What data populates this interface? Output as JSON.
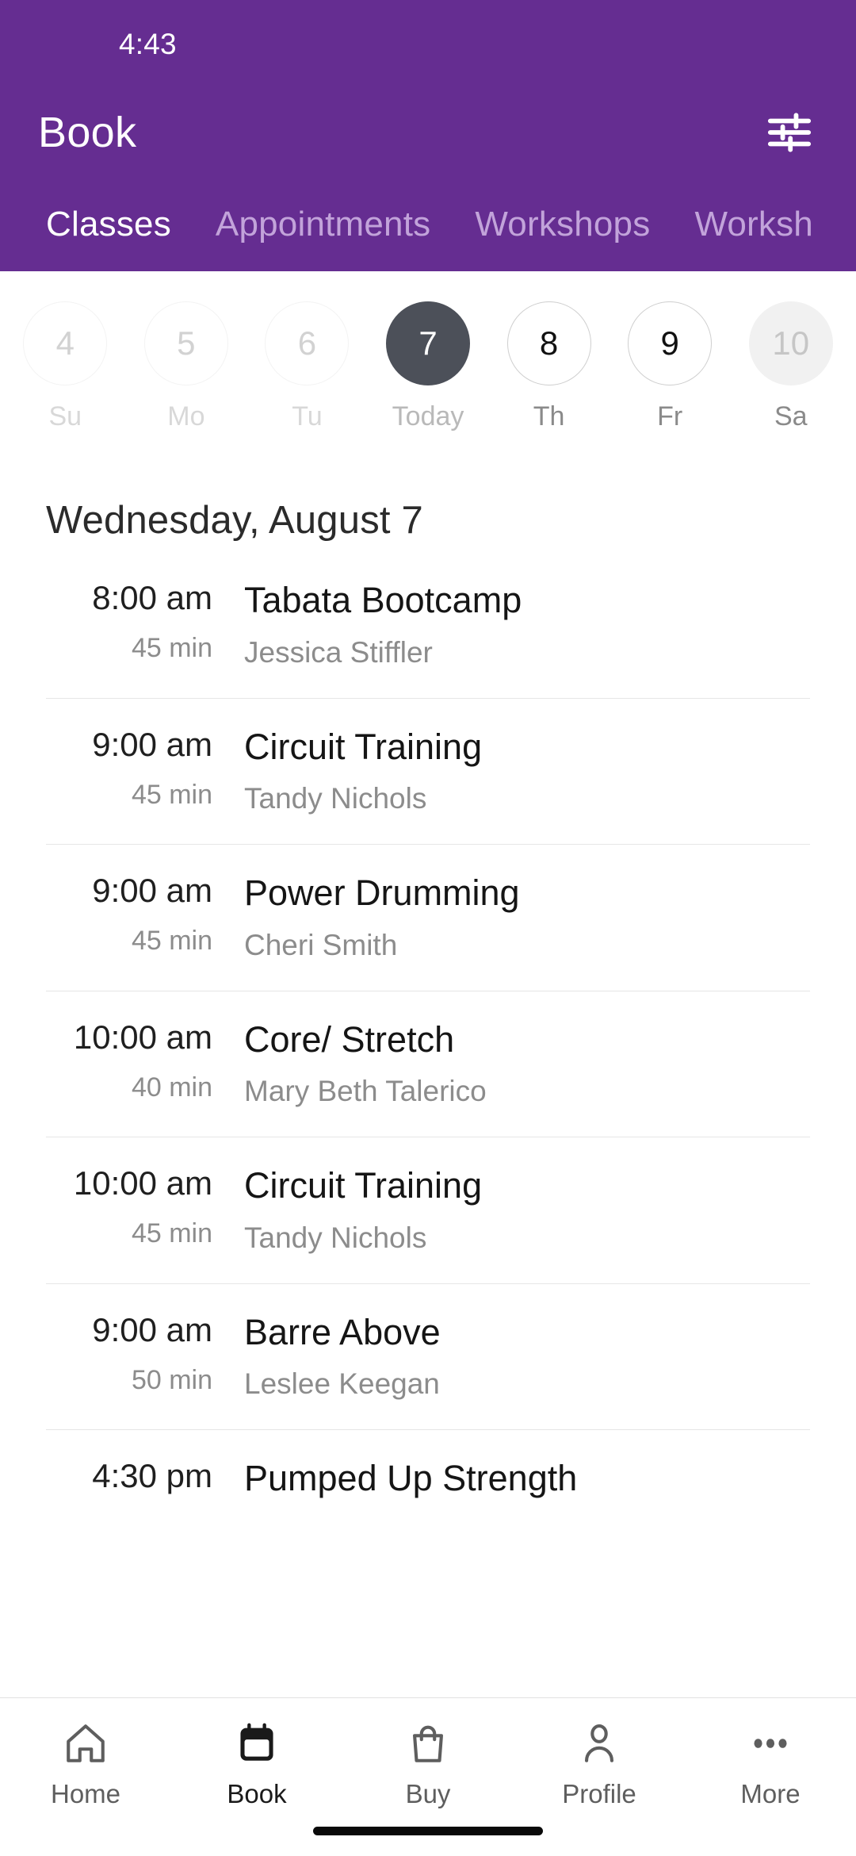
{
  "status_bar": {
    "time": "4:43"
  },
  "header": {
    "title": "Book",
    "filter_icon": "sliders-filter-icon",
    "background_color": "#652D91",
    "tabs": [
      {
        "label": "Classes",
        "active": true
      },
      {
        "label": "Appointments",
        "active": false
      },
      {
        "label": "Workshops",
        "active": false
      },
      {
        "label": "Worksh",
        "active": false
      }
    ]
  },
  "date_strip": {
    "days": [
      {
        "date": "4",
        "label": "Su",
        "state": "past"
      },
      {
        "date": "5",
        "label": "Mo",
        "state": "past"
      },
      {
        "date": "6",
        "label": "Tu",
        "state": "past"
      },
      {
        "date": "7",
        "label": "Today",
        "state": "today"
      },
      {
        "date": "8",
        "label": "Th",
        "state": "avail"
      },
      {
        "date": "9",
        "label": "Fr",
        "state": "avail"
      },
      {
        "date": "10",
        "label": "Sa",
        "state": "muted"
      }
    ],
    "selected_color": "#4C5059"
  },
  "day_heading": "Wednesday, August 7",
  "classes": [
    {
      "time": "8:00 am",
      "duration": "45 min",
      "name": "Tabata Bootcamp",
      "instructor": "Jessica Stiffler"
    },
    {
      "time": "9:00 am",
      "duration": "45 min",
      "name": "Circuit Training",
      "instructor": "Tandy Nichols"
    },
    {
      "time": "9:00 am",
      "duration": "45 min",
      "name": "Power Drumming",
      "instructor": "Cheri Smith"
    },
    {
      "time": "10:00 am",
      "duration": "40 min",
      "name": "Core/ Stretch",
      "instructor": "Mary Beth Talerico"
    },
    {
      "time": "10:00 am",
      "duration": "45 min",
      "name": "Circuit Training",
      "instructor": "Tandy Nichols"
    },
    {
      "time": "9:00 am",
      "duration": "50 min",
      "name": "Barre Above",
      "instructor": "Leslee Keegan"
    },
    {
      "time": "4:30 pm",
      "duration": "",
      "name": "Pumped Up Strength",
      "instructor": ""
    }
  ],
  "bottom_nav": {
    "items": [
      {
        "label": "Home",
        "icon": "home-icon",
        "active": false
      },
      {
        "label": "Book",
        "icon": "calendar-icon",
        "active": true
      },
      {
        "label": "Buy",
        "icon": "bag-icon",
        "active": false
      },
      {
        "label": "Profile",
        "icon": "person-icon",
        "active": false
      },
      {
        "label": "More",
        "icon": "ellipsis-icon",
        "active": false
      }
    ]
  }
}
